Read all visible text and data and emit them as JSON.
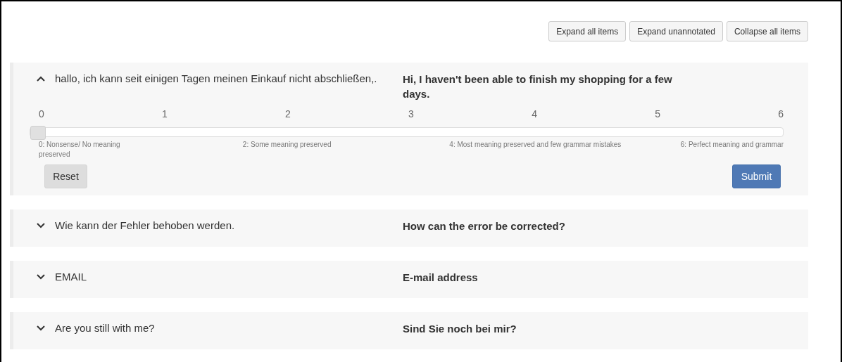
{
  "toolbar": {
    "buttons": [
      "Expand all items",
      "Expand unannotated",
      "Collapse all items"
    ]
  },
  "items": [
    {
      "source": "hallo, ich kann seit einigen Tagen meinen Einkauf nicht abschließen,.",
      "translation": "Hi, I haven't been able to finish my shopping for a few days.",
      "expanded": true,
      "rating": {
        "ticks": [
          {
            "label": "0",
            "description": "0: Nonsense/ No meaning preserved"
          },
          {
            "label": "1"
          },
          {
            "label": "2",
            "description": "2: Some meaning preserved"
          },
          {
            "label": "3"
          },
          {
            "label": "4",
            "description": "4: Most meaning preserved and few grammar mistakes"
          },
          {
            "label": "5"
          },
          {
            "label": "6",
            "description": "6: Perfect meaning and grammar"
          }
        ],
        "level": 0,
        "reset": "Reset",
        "submit": "Submit"
      }
    },
    {
      "source": "Wie kann der Fehler behoben werden.",
      "translation": "How can the error be corrected?",
      "expanded": false
    },
    {
      "source": "EMAIL",
      "translation": "E-mail address",
      "expanded": false
    },
    {
      "source": "Are you still with me?",
      "translation": "Sind Sie noch bei mir?",
      "expanded": false
    }
  ]
}
